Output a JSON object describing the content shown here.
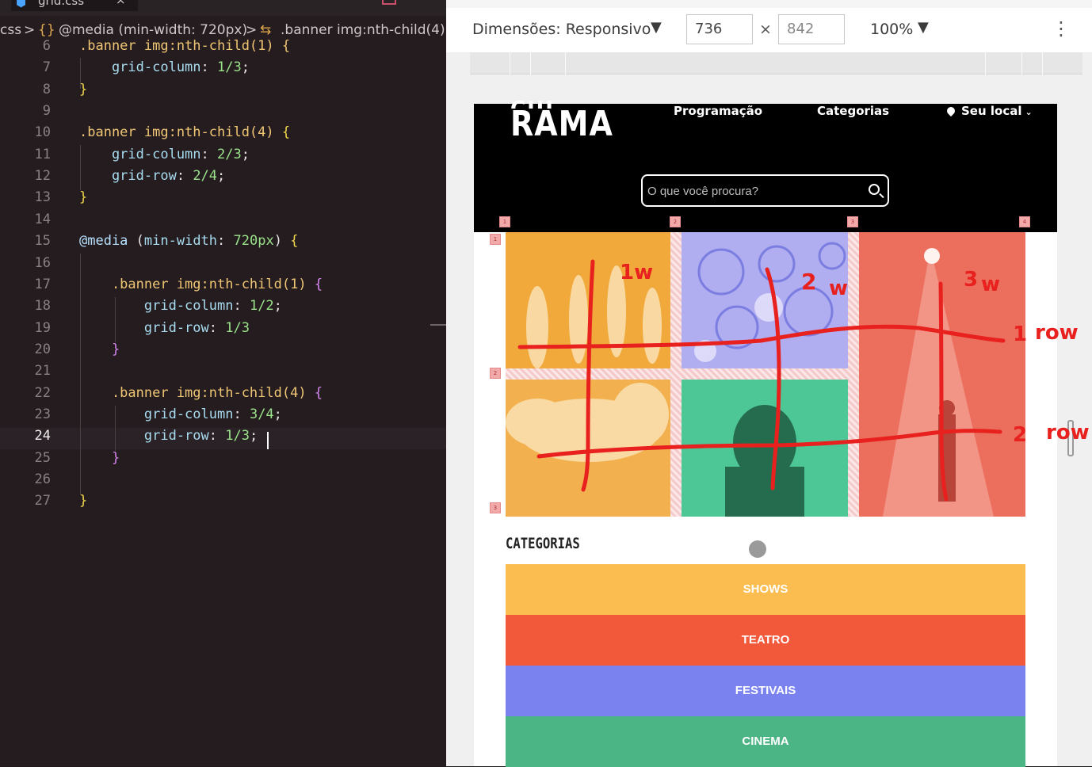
{
  "editor": {
    "tab_filename": "grid.css",
    "tab_close": "×",
    "breadcrumb": {
      "file": "css",
      "sep1": ">",
      "media_icon": "{}",
      "media": "@media (min-width: 720px)",
      "sep2": ">",
      "selector_icon": "⇆",
      "selector": ".banner img:nth-child(4)"
    },
    "current_line": "24",
    "lines": [
      {
        "n": "6",
        "parts": [
          [
            ".banner img:nth-child(1) {",
            "k-sel"
          ]
        ]
      },
      {
        "n": "7",
        "parts": [
          [
            "    grid-column",
            "k-prop"
          ],
          [
            ": ",
            "k-plain"
          ],
          [
            "1/3",
            "k-val"
          ],
          [
            ";",
            "k-plain"
          ]
        ]
      },
      {
        "n": "8",
        "parts": [
          [
            "}",
            "k-brace-y"
          ]
        ]
      },
      {
        "n": "9",
        "parts": []
      },
      {
        "n": "10",
        "parts": [
          [
            ".banner img:nth-child(4) ",
            "k-sel"
          ],
          [
            "{",
            "k-brace-y"
          ]
        ]
      },
      {
        "n": "11",
        "parts": [
          [
            "    grid-column",
            "k-prop"
          ],
          [
            ": ",
            "k-plain"
          ],
          [
            "2/3",
            "k-val"
          ],
          [
            ";",
            "k-plain"
          ]
        ]
      },
      {
        "n": "12",
        "parts": [
          [
            "    grid-row",
            "k-prop"
          ],
          [
            ": ",
            "k-plain"
          ],
          [
            "2/4",
            "k-val"
          ],
          [
            ";",
            "k-plain"
          ]
        ]
      },
      {
        "n": "13",
        "parts": [
          [
            "}",
            "k-brace-y"
          ]
        ]
      },
      {
        "n": "14",
        "parts": []
      },
      {
        "n": "15",
        "parts": [
          [
            "@media",
            "k-at"
          ],
          [
            " (",
            "k-plain"
          ],
          [
            "min-width",
            "k-prop"
          ],
          [
            ": ",
            "k-plain"
          ],
          [
            "720px",
            "k-val"
          ],
          [
            ") ",
            "k-plain"
          ],
          [
            "{",
            "k-brace-y"
          ]
        ]
      },
      {
        "n": "16",
        "parts": []
      },
      {
        "n": "17",
        "parts": [
          [
            "    .banner img:nth-child(1) ",
            "k-sel"
          ],
          [
            "{",
            "k-brace-p"
          ]
        ]
      },
      {
        "n": "18",
        "parts": [
          [
            "        grid-column",
            "k-prop"
          ],
          [
            ": ",
            "k-plain"
          ],
          [
            "1/2",
            "k-val"
          ],
          [
            ";",
            "k-plain"
          ]
        ]
      },
      {
        "n": "19",
        "parts": [
          [
            "        grid-row",
            "k-prop"
          ],
          [
            ": ",
            "k-plain"
          ],
          [
            "1/3",
            "k-val"
          ]
        ]
      },
      {
        "n": "20",
        "parts": [
          [
            "    }",
            "k-brace-p"
          ]
        ]
      },
      {
        "n": "21",
        "parts": []
      },
      {
        "n": "22",
        "parts": [
          [
            "    .banner img:nth-child(4) ",
            "k-sel"
          ],
          [
            "{",
            "k-brace-p"
          ]
        ]
      },
      {
        "n": "23",
        "parts": [
          [
            "        grid-column",
            "k-prop"
          ],
          [
            ": ",
            "k-plain"
          ],
          [
            "3/4",
            "k-val"
          ],
          [
            ";",
            "k-plain"
          ]
        ]
      },
      {
        "n": "24",
        "parts": [
          [
            "        grid-row",
            "k-prop"
          ],
          [
            ": ",
            "k-plain"
          ],
          [
            "1/3",
            "k-val"
          ],
          [
            ";",
            "k-plain"
          ]
        ]
      },
      {
        "n": "25",
        "parts": [
          [
            "    }",
            "k-brace-p"
          ]
        ]
      },
      {
        "n": "26",
        "parts": []
      },
      {
        "n": "27",
        "parts": [
          [
            "}",
            "k-brace-y"
          ]
        ]
      }
    ]
  },
  "devtools": {
    "dimensions_label": "Dimensões: Responsivo",
    "dropdown_caret": "▼",
    "width": "736",
    "times": "×",
    "height": "842",
    "zoom": "100%",
    "menu": "⋮"
  },
  "site": {
    "logo_top": "CUL",
    "logo_bottom": "RAMA",
    "nav": [
      "Programação",
      "Categorias",
      "Seu local"
    ],
    "nav_chevron": "⌄",
    "search_placeholder": "O que você procura?",
    "banner_tiles": [
      {
        "name": "banner-ballet",
        "color": "#f0a93a"
      },
      {
        "name": "banner-abstract",
        "color": "#a9a6ee"
      },
      {
        "name": "banner-teatro",
        "color": "#ec6f5e"
      },
      {
        "name": "banner-portrait",
        "color": "#4cc795"
      }
    ],
    "categories_title": "CATEGORIAS",
    "categories": [
      {
        "label": "SHOWS",
        "color": "#fbbd4f"
      },
      {
        "label": "TEATRO",
        "color": "#f2583a"
      },
      {
        "label": "FESTIVAIS",
        "color": "#7a82ef"
      },
      {
        "label": "CINEMA",
        "color": "#4bb585"
      }
    ]
  },
  "annotations": {
    "col1": "1w",
    "col2_num": "2",
    "col2_w": "w",
    "col3_num": "3",
    "col3_w": "w",
    "row1_num": "1",
    "row1_word": "row",
    "row2_num": "2",
    "row2_word": "row"
  }
}
